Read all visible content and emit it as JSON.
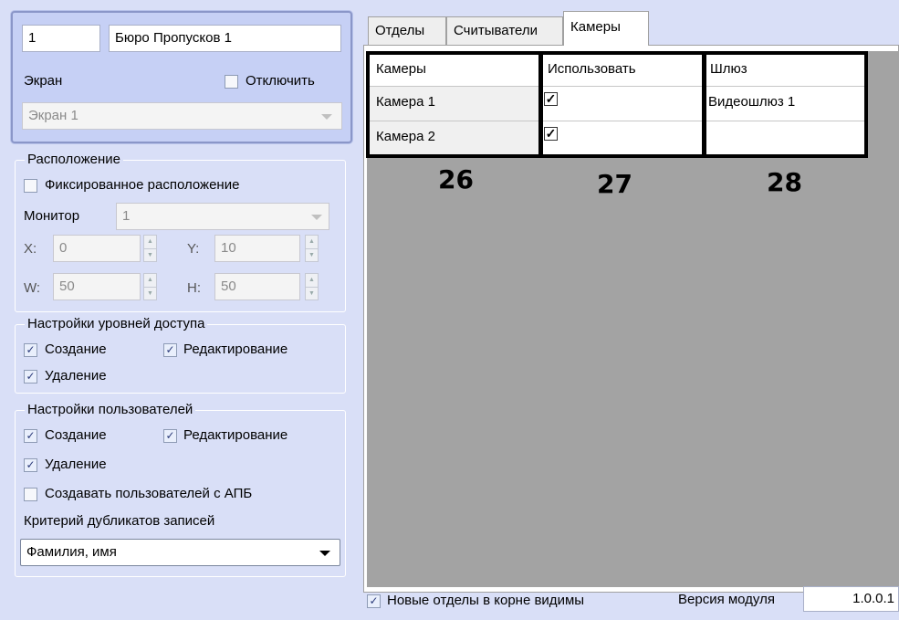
{
  "left_panel": {
    "id_value": "1",
    "name_value": "Бюро Пропусков 1",
    "screen_label": "Экран",
    "disable_label": "Отключить",
    "screen_select": "Экран 1"
  },
  "location_group": {
    "title": "Расположение",
    "fixed_label": "Фиксированное расположение",
    "monitor_label": "Монитор",
    "monitor_value": "1",
    "x_label": "X:",
    "x_value": "0",
    "y_label": "Y:",
    "y_value": "10",
    "w_label": "W:",
    "w_value": "50",
    "h_label": "H:",
    "h_value": "50"
  },
  "access_group": {
    "title": "Настройки уровней доступа",
    "create_label": "Создание",
    "edit_label": "Редактирование",
    "delete_label": "Удаление"
  },
  "users_group": {
    "title": "Настройки пользователей",
    "create_label": "Создание",
    "edit_label": "Редактирование",
    "delete_label": "Удаление",
    "apb_label": "Создавать пользователей с АПБ",
    "criterion_label": "Критерий дубликатов записей",
    "criterion_value": "Фамилия, имя"
  },
  "tabs": [
    {
      "label": "Отделы"
    },
    {
      "label": "Считыватели"
    },
    {
      "label": "Камеры"
    }
  ],
  "grid": {
    "headers": [
      "Камеры",
      "Использовать",
      "Шлюз"
    ],
    "rows": [
      {
        "camera": "Камера 1",
        "use_mark": "✓",
        "gateway": "Видеошлюз 1"
      },
      {
        "camera": "Камера 2",
        "use_mark": "✓",
        "gateway": ""
      }
    ]
  },
  "callouts": [
    "26",
    "27",
    "28"
  ],
  "footer": {
    "new_depts_label": "Новые отделы в корне видимы",
    "version_label": "Версия модуля",
    "version_value": "1.0.0.1"
  },
  "check_mark": "✓"
}
